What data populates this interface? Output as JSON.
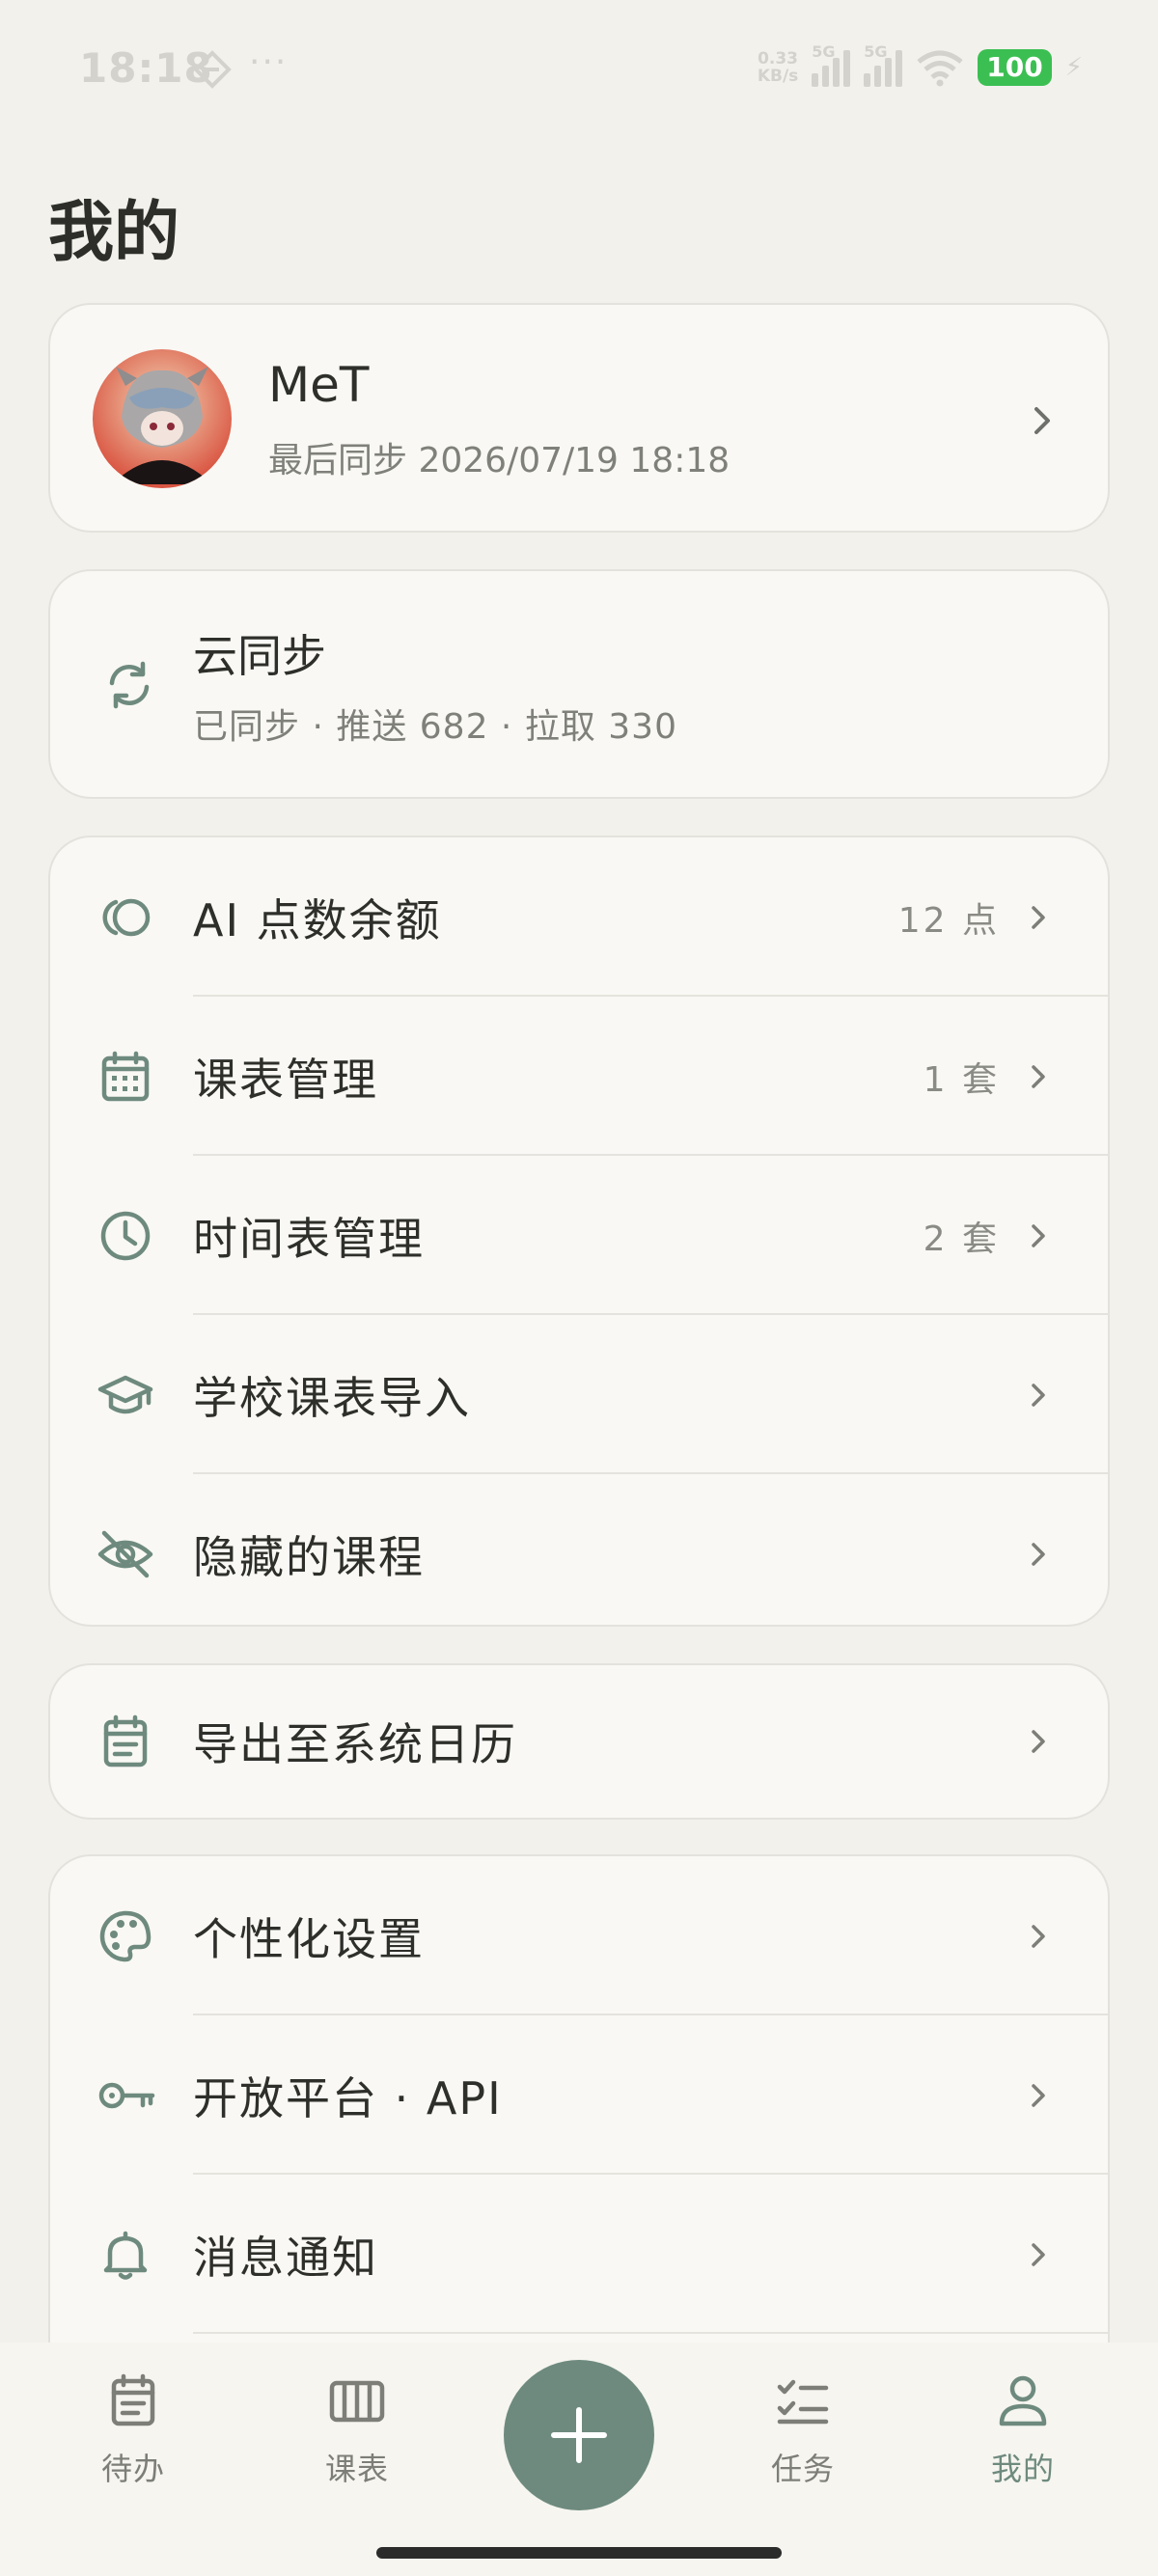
{
  "status_bar": {
    "time": "18:18",
    "dots": "···",
    "speed_top": "0.33",
    "speed_bottom": "KB/s",
    "net1": "5G",
    "net2": "5G",
    "battery": "100"
  },
  "page": {
    "title": "我的"
  },
  "profile": {
    "name": "MeT",
    "last_sync": "最后同步 2026/07/19 18:18"
  },
  "cloud_sync": {
    "title": "云同步",
    "status": "已同步 · 推送 682 · 拉取 330"
  },
  "group1": [
    {
      "label": "AI 点数余额",
      "value": "12 点",
      "icon": "coin-icon"
    },
    {
      "label": "课表管理",
      "value": "1 套",
      "icon": "calendar-grid-icon"
    },
    {
      "label": "时间表管理",
      "value": "2 套",
      "icon": "clock-icon"
    },
    {
      "label": "学校课表导入",
      "value": "",
      "icon": "graduation-cap-icon"
    },
    {
      "label": "隐藏的课程",
      "value": "",
      "icon": "eye-off-icon"
    }
  ],
  "group2": [
    {
      "label": "导出至系统日历",
      "value": "",
      "icon": "calendar-export-icon"
    }
  ],
  "group3": [
    {
      "label": "个性化设置",
      "value": "",
      "icon": "palette-icon"
    },
    {
      "label": "开放平台 · API",
      "value": "",
      "icon": "key-icon"
    },
    {
      "label": "消息通知",
      "value": "",
      "icon": "bell-icon"
    }
  ],
  "bottom_nav": {
    "todo": "待办",
    "schedule": "课表",
    "tasks": "任务",
    "mine": "我的",
    "active": "mine"
  },
  "colors": {
    "accent": "#6e8a7e",
    "background": "#f2f1ec",
    "card": "#f9f8f4",
    "battery": "#3bbf52"
  }
}
